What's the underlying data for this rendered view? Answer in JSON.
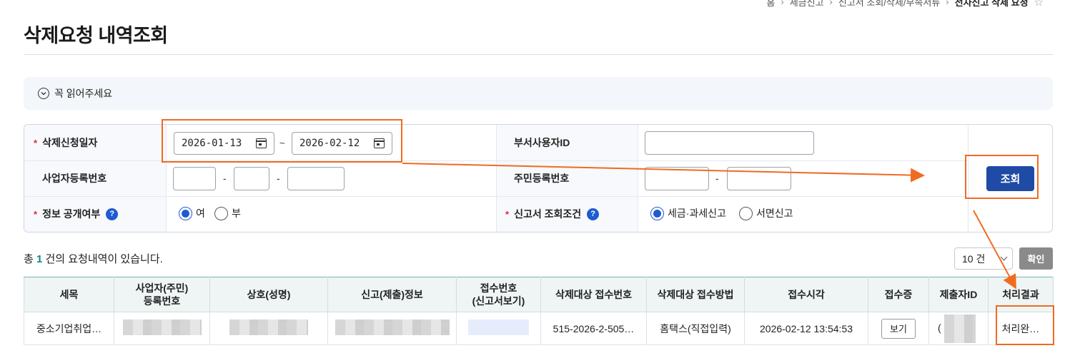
{
  "breadcrumb": {
    "items": [
      "홈",
      "세금신고",
      "신고서 조회/삭제/부속서류",
      "전자신고 삭제 요청"
    ]
  },
  "page": {
    "title": "삭제요청 내역조회"
  },
  "notice": {
    "label": "꼭 읽어주세요"
  },
  "search": {
    "delete_date_label": "삭제신청일자",
    "date_from": "2026-01-13",
    "date_to": "2026-02-12",
    "tilde": "~",
    "dept_user_label": "부서사용자ID",
    "dept_user_value": "",
    "biz_no_label": "사업자등록번호",
    "resident_no_label": "주민등록번호",
    "dash": "-",
    "disclose_label": "정보 공개여부",
    "disclose_options": [
      "여",
      "부"
    ],
    "disclose_selected": "여",
    "report_cond_label": "신고서 조회조건",
    "report_options": [
      "세금·과세신고",
      "서면신고"
    ],
    "report_selected": "세금·과세신고",
    "search_button": "조회",
    "required_mark": "*",
    "help_mark": "?"
  },
  "results": {
    "total_prefix": "총",
    "total_count": "1",
    "total_suffix": "건의 요청내역이 있습니다.",
    "page_size": "10 건",
    "confirm_button": "확인"
  },
  "table": {
    "headers": [
      "세목",
      "사업자(주민)\n등록번호",
      "상호(성명)",
      "신고(제출)정보",
      "접수번호\n(신고서보기)",
      "삭제대상 접수번호",
      "삭제대상 접수방법",
      "접수시각",
      "접수증",
      "제출자ID",
      "처리결과"
    ],
    "rows": [
      {
        "tax_item": "중소기업취업…",
        "del_receipt_no": "515-2026-2-505…",
        "del_method": "홈택스(직접입력)",
        "received_at": "2026-02-12 13:54:53",
        "receipt_btn": "보기",
        "submitter_id": "(",
        "result": "처리완…"
      }
    ]
  },
  "colors": {
    "highlight": "#ef6b22",
    "primary": "#1f4aa6",
    "accent": "#0a8a8a"
  }
}
